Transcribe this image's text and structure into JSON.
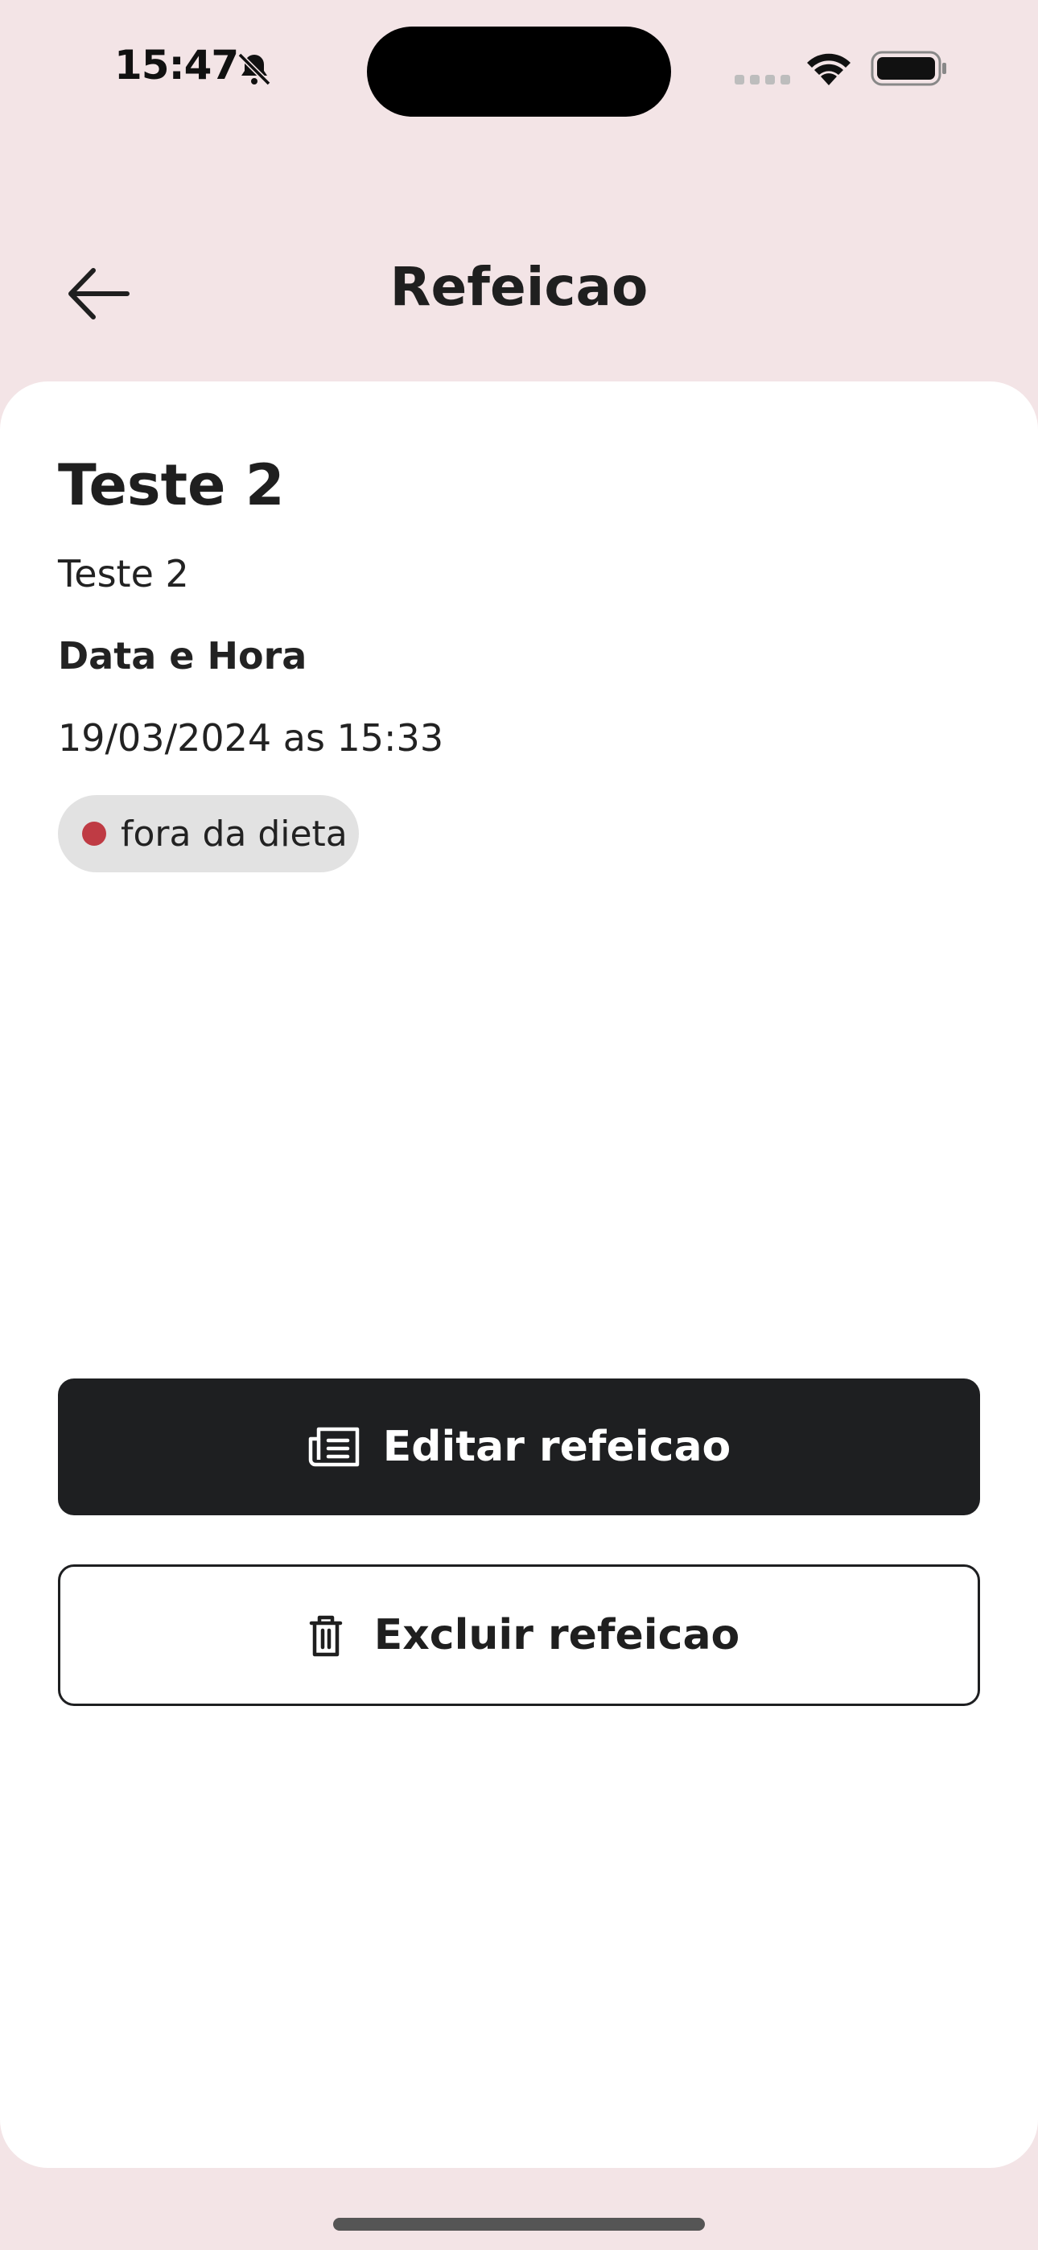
{
  "status_bar": {
    "time": "15:47"
  },
  "header": {
    "title": "Refeicao"
  },
  "meal": {
    "name": "Teste 2",
    "description": "Teste 2",
    "datetime_label": "Data e Hora",
    "datetime_value": "19/03/2024 as 15:33",
    "diet_tag": {
      "label": "fora da dieta",
      "dot_color": "#BF3B44"
    }
  },
  "actions": {
    "edit_label": "Editar refeicao",
    "delete_label": "Excluir refeicao"
  },
  "colors": {
    "background": "#F3E4E6",
    "card": "#FFFFFF",
    "primary_button": "#1E1F21",
    "tag_background": "#E2E2E2",
    "off_diet": "#BF3B44"
  },
  "icons": [
    "bell-slash-icon",
    "signal-icon",
    "wifi-icon",
    "battery-icon",
    "arrow-left-icon",
    "edit-icon",
    "trash-icon"
  ]
}
